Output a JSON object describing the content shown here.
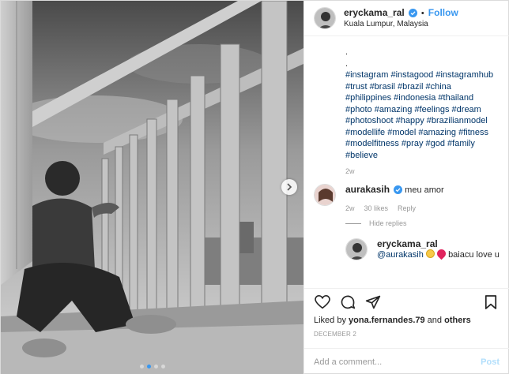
{
  "header": {
    "username": "eryckama_ral",
    "separator": "•",
    "follow_label": "Follow",
    "location": "Kuala Lumpur, Malaysia"
  },
  "caption": {
    "dot_lines": [
      ".",
      "."
    ],
    "hashtags": "#instagram #instagood #instagramhub #trust #brasil #brazil #china #philippines #indonesia #thailand #photo #amazing #feelings #dream #photoshoot #happy #brazilianmodel #modellife #model #amazing #fitness #modelfitness #pray #god #family #believe",
    "time": "2w"
  },
  "comments": [
    {
      "username": "aurakasih",
      "text": "meu amor",
      "time": "2w",
      "likes": "30 likes",
      "reply_label": "Reply"
    }
  ],
  "hide_replies_label": "Hide replies",
  "reply": {
    "username": "eryckama_ral",
    "mention": "@aurakasih",
    "text_after_emojis": " baiacu love u"
  },
  "actions": {
    "liked_prefix": "Liked by ",
    "liked_user": "yona.fernandes.79",
    "liked_mid": " and ",
    "liked_others": "others",
    "date": "DECEMBER 2"
  },
  "add_comment": {
    "placeholder": "Add a comment...",
    "post_label": "Post"
  },
  "colors": {
    "link_blue": "#3897f0",
    "hashtag": "#003569",
    "muted": "#999999"
  },
  "icons": [
    "verified-badge-icon",
    "heart-icon",
    "comment-icon",
    "share-icon",
    "bookmark-icon",
    "chevron-right-icon"
  ],
  "carousel": {
    "total": 4,
    "active_index": 1
  }
}
